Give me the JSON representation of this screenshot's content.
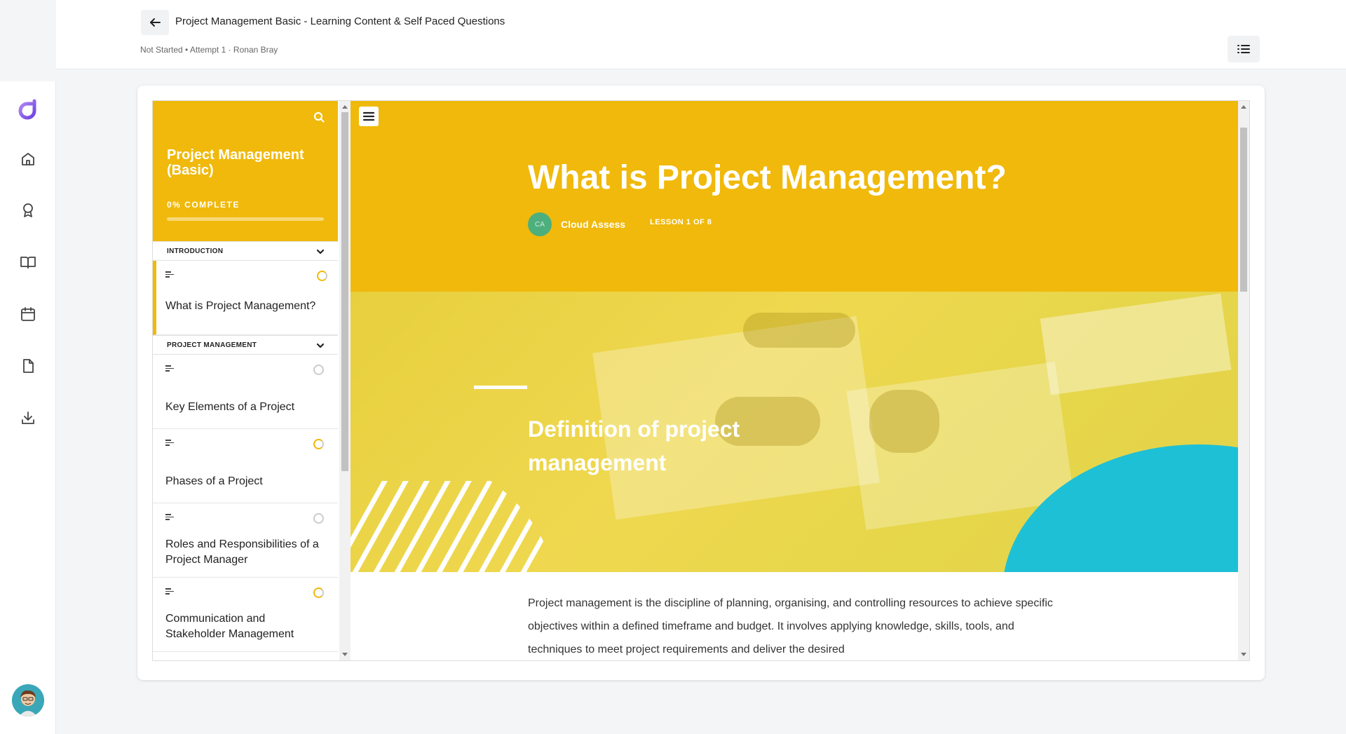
{
  "header": {
    "title": "Project Management Basic - Learning Content & Self Paced Questions",
    "subtitle": "Not Started • Attempt 1 · Ronan Bray"
  },
  "rail": {
    "icons": [
      "home-icon",
      "award-icon",
      "book-icon",
      "calendar-icon",
      "document-icon",
      "download-icon"
    ]
  },
  "course": {
    "title": "Project Management (Basic)",
    "progress_label": "0% COMPLETE",
    "progress": 0,
    "sections": [
      {
        "label": "INTRODUCTION",
        "lessons": [
          {
            "name": "What is Project Management?",
            "status": "in-progress"
          }
        ]
      },
      {
        "label": "PROJECT MANAGEMENT",
        "lessons": [
          {
            "name": "Key Elements of a Project",
            "status": "not-started"
          },
          {
            "name": "Phases of a Project",
            "status": "in-progress"
          },
          {
            "name": "Roles and Responsibilities of a Project Manager",
            "status": "not-started"
          },
          {
            "name": "Communication and Stakeholder Management",
            "status": "in-progress"
          }
        ]
      }
    ]
  },
  "lesson": {
    "title": "What is Project Management?",
    "author_initials": "CA",
    "author": "Cloud Assess",
    "count": "LESSON 1 OF 8",
    "banner_heading": "Definition of project management",
    "body": "Project management is the discipline of planning, organising, and controlling resources to achieve specific objectives within a defined timeframe and budget. It involves applying knowledge, skills, tools, and techniques to meet project requirements and deliver the desired"
  },
  "colors": {
    "accent": "#f0b90b",
    "cyan": "#1ec0d6",
    "brand": "#8b5cf6"
  }
}
